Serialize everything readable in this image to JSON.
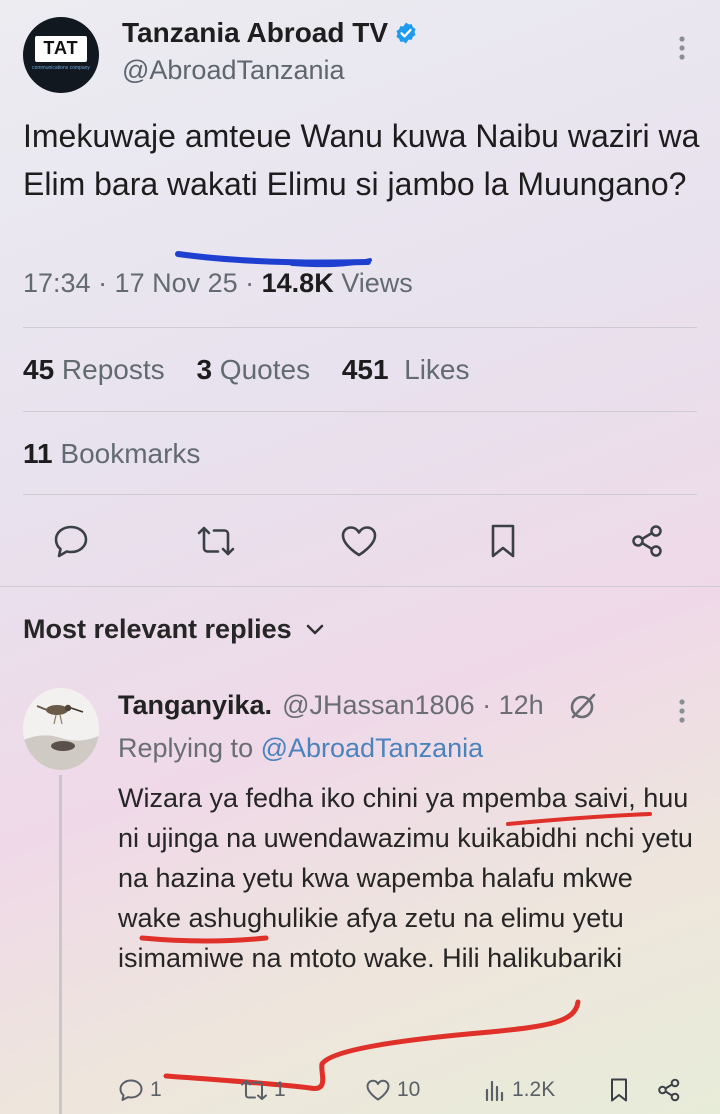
{
  "tweet": {
    "avatar_text": "TAT",
    "avatar_subtext": "communications company",
    "display_name": "Tanzania Abroad TV",
    "handle": "@AbroadTanzania",
    "text": "Imekuwaje amteue Wanu kuwa Naibu waziri wa Elim bara wakati Elimu si jambo la Muungano?",
    "time": "17:34 · 17 Nov 25 · ",
    "views_count": "14.8K",
    "views_label": " Views"
  },
  "stats": {
    "reposts_count": "45",
    "reposts_label": " Reposts",
    "quotes_count": "3",
    "quotes_label": " Quotes",
    "likes_count": "451",
    "likes_label": "  Likes",
    "bookmarks_count": "11",
    "bookmarks_label": " Bookmarks"
  },
  "replies_section": {
    "title": "Most relevant replies"
  },
  "reply": {
    "display_name": "Tanganyika.",
    "handle_time": "@JHassan1806 · 12h",
    "replying_label": "Replying to ",
    "replying_to": "@AbroadTanzania",
    "text": "Wizara ya fedha iko chini ya mpemba saivi, huu ni ujinga na uwendawazimu kuikabidhi nchi yetu na hazina yetu kwa wapemba halafu mkwe wake ashughulikie afya zetu na elimu yetu isimamiwe na mtoto wake. Hili halikubariki",
    "replies": "1",
    "reposts": "1",
    "likes": "10",
    "views": "1.2K"
  },
  "colors": {
    "verified": "#1d9bf0",
    "annotation_blue": "#1f3fd1",
    "annotation_red": "#e0302a"
  }
}
